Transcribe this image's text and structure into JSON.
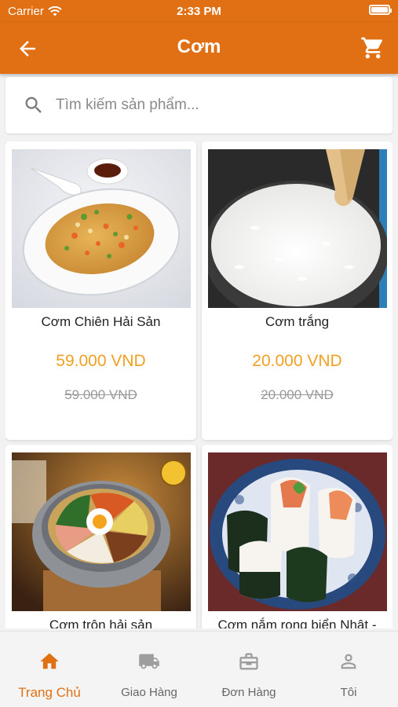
{
  "status": {
    "carrier": "Carrier",
    "time": "2:33 PM"
  },
  "header": {
    "title": "Cơm",
    "back_icon": "arrow-back-icon",
    "cart_icon": "cart-icon"
  },
  "search": {
    "placeholder": "Tìm kiếm sản phẩm...",
    "value": "",
    "icon": "search-icon"
  },
  "products": [
    {
      "name": "Cơm Chiên Hải Sản",
      "price": "59.000 VND",
      "old_price": "59.000 VND"
    },
    {
      "name": "Cơm trắng",
      "price": "20.000 VND",
      "old_price": "20.000 VND"
    },
    {
      "name": "Cơm trộn hải sản",
      "price": "",
      "old_price": ""
    },
    {
      "name": "Cơm nắm rong biển Nhật -",
      "price": "",
      "old_price": ""
    }
  ],
  "tabs": [
    {
      "label": "Trang Chủ",
      "icon": "home-icon",
      "active": true
    },
    {
      "label": "Giao Hàng",
      "icon": "truck-icon",
      "active": false
    },
    {
      "label": "Đơn Hàng",
      "icon": "briefcase-icon",
      "active": false
    },
    {
      "label": "Tôi",
      "icon": "user-icon",
      "active": false
    }
  ],
  "colors": {
    "primary": "#e07013",
    "price": "#f0a022",
    "inactive_tab": "#9e9e9e"
  }
}
